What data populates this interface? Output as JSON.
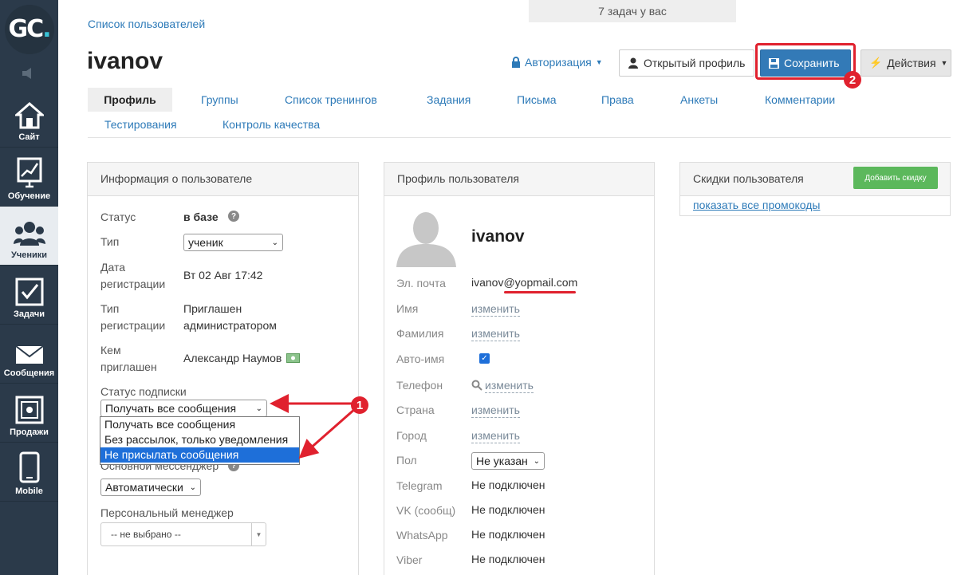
{
  "sidebar": {
    "logo_text": "GC",
    "logo_dot": ".",
    "items": [
      {
        "label": "Сайт",
        "icon": "house-icon"
      },
      {
        "label": "Обучение",
        "icon": "chart-easel-icon"
      },
      {
        "label": "Ученики",
        "icon": "users-icon"
      },
      {
        "label": "Задачи",
        "icon": "checkbox-icon"
      },
      {
        "label": "Сообщения",
        "icon": "envelope-icon"
      },
      {
        "label": "Продажи",
        "icon": "safe-icon"
      },
      {
        "label": "Mobile",
        "icon": "phone-icon"
      }
    ]
  },
  "header": {
    "tasks": "7 задач у вас",
    "breadcrumb": "Список пользователей",
    "title": "ivanov",
    "auth_label": "Авторизация",
    "profile_button": "Открытый профиль",
    "save_button": "Сохранить",
    "actions_button": "Действия"
  },
  "tabs": [
    "Профиль",
    "Группы",
    "Список тренингов",
    "Задания",
    "Письма",
    "Права",
    "Анкеты",
    "Комментарии",
    "Тестирования",
    "Контроль качества"
  ],
  "user_info": {
    "title": "Информация о пользователе",
    "status_label": "Статус",
    "status_value": "в базе",
    "type_label": "Тип",
    "type_value": "ученик",
    "reg_date_label_1": "Дата",
    "reg_date_label_2": "регистрации",
    "reg_date_value": "Вт 02 Авг 17:42",
    "reg_type_label_1": "Тип",
    "reg_type_label_2": "регистрации",
    "reg_type_value_1": "Приглашен",
    "reg_type_value_2": "администратором",
    "invited_label_1": "Кем",
    "invited_label_2": "приглашен",
    "invited_value": "Александр Наумов",
    "subscription_label": "Статус подписки",
    "subscription_value": "Получать все сообщения",
    "subscription_options": [
      "Получать все сообщения",
      "Без рассылок, только уведомления",
      "Не присылать сообщения"
    ],
    "messenger_label": "Основной мессенджер",
    "messenger_value": "Автоматически",
    "manager_label": "Персональный менеджер",
    "manager_value": "-- не выбрано --"
  },
  "profile": {
    "title": "Профиль пользователя",
    "username": "ivanov",
    "email_label": "Эл. почта",
    "email_value": "ivanov@yopmail.com",
    "change_link": "изменить",
    "name_label": "Имя",
    "surname_label": "Фамилия",
    "autoname_label": "Авто-имя",
    "phone_label": "Телефон",
    "country_label": "Страна",
    "city_label": "Город",
    "gender_label": "Пол",
    "gender_value": "Не указан",
    "telegram_label": "Telegram",
    "vk_label": "VK (сообщ)",
    "whatsapp_label": "WhatsApp",
    "viber_label": "Viber",
    "not_connected": "Не подключен"
  },
  "discounts": {
    "title": "Скидки пользователя",
    "add_button": "Добавить скидку",
    "show_all": "показать все промокоды"
  },
  "annotations": {
    "badge_1": "1",
    "badge_2": "2"
  },
  "colors": {
    "accent": "#337ab7",
    "link": "#2d7ab8",
    "highlight": "#e0212e",
    "sidebar": "#2b3a4a",
    "green": "#5cb85c"
  }
}
